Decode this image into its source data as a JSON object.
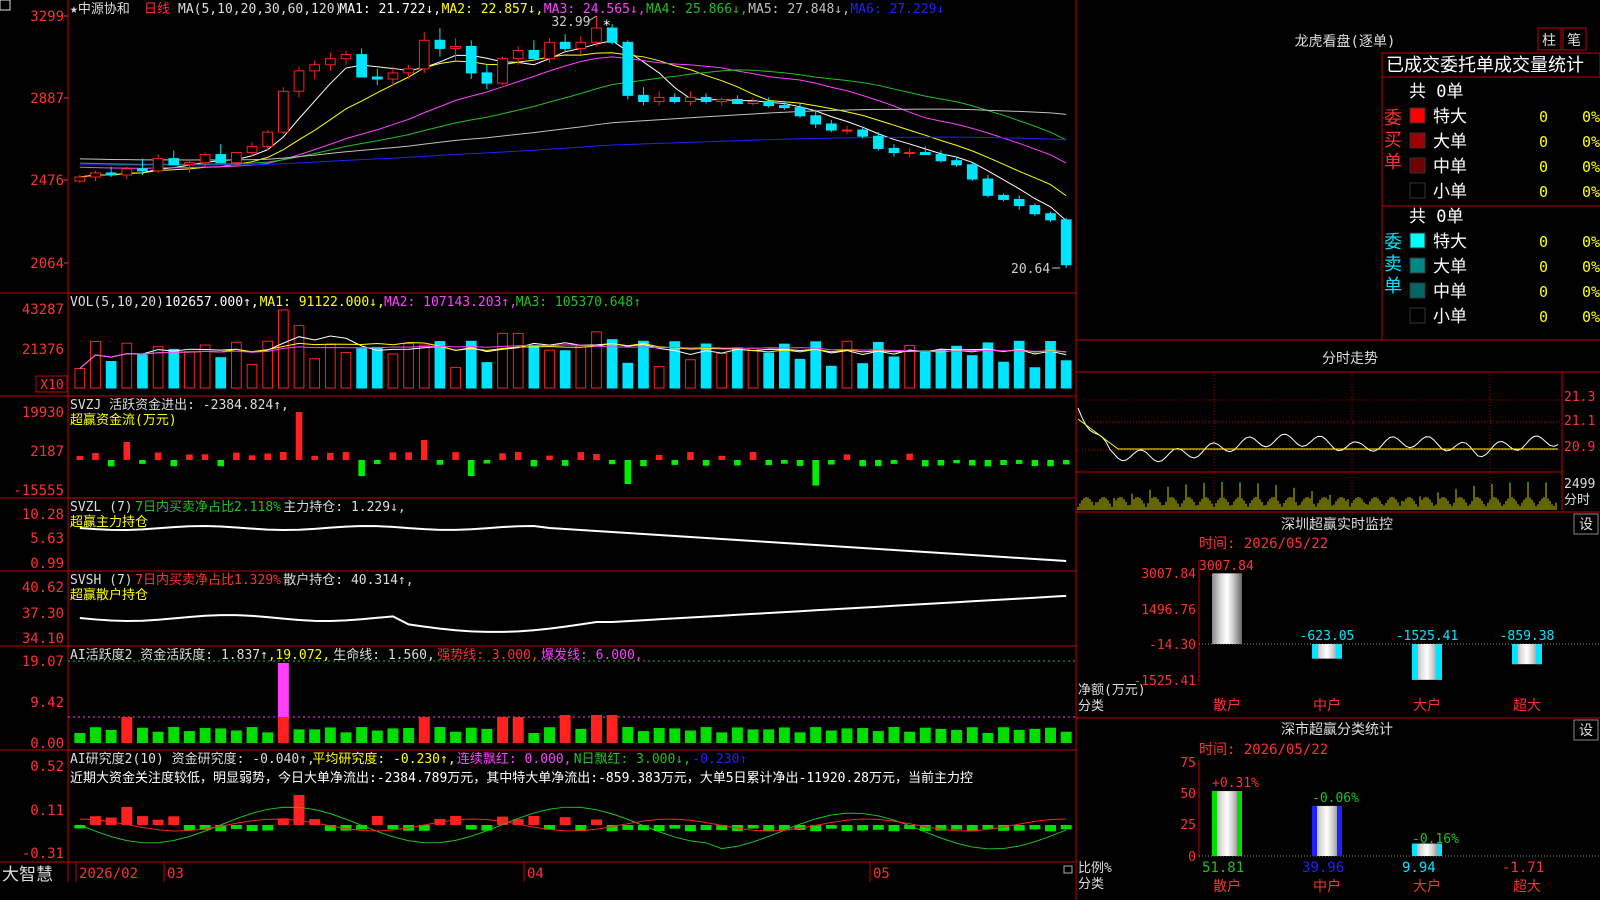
{
  "app_title": "★中源协和",
  "period_label": "日线",
  "bottom_logo": "大智慧",
  "colors": {
    "up": "#ff2020",
    "down": "#00e5ff",
    "ma1": "#ffffff",
    "ma2": "#ffff00",
    "ma3": "#ff40ff",
    "ma4": "#20c020",
    "ma5": "#c0c0c0",
    "ma6": "#2020ff",
    "frame": "#c00000",
    "axis_text": "#ff3030"
  },
  "main_panel": {
    "ma_header": [
      {
        "label": "MA(5,10,20,30,60,120)",
        "color": "#dddddd"
      },
      {
        "label": "MA1: 21.722↓,",
        "color": "#ffffff"
      },
      {
        "label": "MA2: 22.857↓,",
        "color": "#ffff00"
      },
      {
        "label": "MA3: 24.565↓,",
        "color": "#ff40ff"
      },
      {
        "label": "MA4: 25.866↓,",
        "color": "#20c020"
      },
      {
        "label": "MA5: 27.848↓,",
        "color": "#c0c0c0"
      },
      {
        "label": "MA6: 27.229↓",
        "color": "#2020ff"
      }
    ],
    "y_ticks": [
      "3299",
      "2887",
      "2476",
      "2064"
    ],
    "high_label": "32.99",
    "low_label": "20.64"
  },
  "vol_panel": {
    "header": [
      {
        "label": "VOL(5,10,20)",
        "color": "#dddddd"
      },
      {
        "label": "102657.000↑,",
        "color": "#ffffff"
      },
      {
        "label": "MA1: 91122.000↓,",
        "color": "#ffff00"
      },
      {
        "label": "MA2: 107143.203↑,",
        "color": "#ff40ff"
      },
      {
        "label": "MA3: 105370.648↑",
        "color": "#20c020"
      }
    ],
    "y_ticks": [
      "43287",
      "21376"
    ],
    "unit": "X10"
  },
  "svzj_panel": {
    "header": [
      {
        "label": "SVZJ  活跃资金进出: -2384.824↑,",
        "color": "#dddddd"
      }
    ],
    "subtitle": "超赢资金流(万元)",
    "y_ticks": [
      "19930",
      "2187",
      "-15555"
    ]
  },
  "svzl_panel": {
    "header": [
      {
        "label": "SVZL (7)",
        "color": "#dddddd"
      },
      {
        "label": "7日内买卖净占比2.118%",
        "color": "#20c020"
      },
      {
        "label": "主力持仓: 1.229↓,",
        "color": "#dddddd"
      }
    ],
    "subtitle": "超赢主力持仓",
    "y_ticks": [
      "10.28",
      "5.63",
      "0.99"
    ]
  },
  "svsh_panel": {
    "header": [
      {
        "label": "SVSH (7)",
        "color": "#dddddd"
      },
      {
        "label": "7日内买卖净占比1.329%",
        "color": "#ff3030"
      },
      {
        "label": "散户持仓: 40.314↑,",
        "color": "#dddddd"
      }
    ],
    "subtitle": "超赢散户持仓",
    "y_ticks": [
      "40.62",
      "37.30",
      "34.10"
    ]
  },
  "ai_active_panel": {
    "header": [
      {
        "label": "AI活跃度2 资金活跃度: 1.837↑,",
        "color": "#dddddd"
      },
      {
        "label": "19.072,",
        "color": "#ffff00"
      },
      {
        "label": "生命线: 1.560,",
        "color": "#dddddd"
      },
      {
        "label": "强势线: 3.000,",
        "color": "#ff3030"
      },
      {
        "label": "爆发线: 6.000,",
        "color": "#ff40ff"
      }
    ],
    "y_ticks": [
      "19.07",
      "9.42",
      "0.00"
    ]
  },
  "ai_research_panel": {
    "header": [
      {
        "label": "AI研究度2(10) 资金研究度: -0.040↑,",
        "color": "#dddddd"
      },
      {
        "label": "平均研究度: -0.230↑,",
        "color": "#ffff00"
      },
      {
        "label": "连续飘红: 0.000,",
        "color": "#ff40ff"
      },
      {
        "label": "N日飘红: 3.000↓,",
        "color": "#20c020"
      },
      {
        "label": "-0.230↑",
        "color": "#2020ff"
      }
    ],
    "comment": "近期大资金关注度较低，明显弱势，今日大单净流出:-2384.789万元，其中特大单净流出:-859.383万元，大单5日累计净出-11920.28万元，当前主力控",
    "y_ticks": [
      "0.52",
      "0.11",
      "-0.31"
    ]
  },
  "date_axis": [
    "2026/02",
    "03",
    "04",
    "05"
  ],
  "right_panel": {
    "dragon_title": "龙虎看盘(逐单)",
    "dragon_tabs": [
      "柱",
      "笔"
    ],
    "order_title": "已成交委托单成交量统计",
    "buy_label": "委买单",
    "sell_label": "委卖单",
    "buy_total": "共 0单",
    "sell_total": "共 0单",
    "buy_rows": [
      {
        "name": "特大",
        "val": "0",
        "pct": "0%",
        "color": "#ff0000"
      },
      {
        "name": "大单",
        "val": "0",
        "pct": "0%",
        "color": "#a00000"
      },
      {
        "name": "中单",
        "val": "0",
        "pct": "0%",
        "color": "#700000"
      },
      {
        "name": "小单",
        "val": "0",
        "pct": "0%",
        "color": "#000000"
      }
    ],
    "sell_rows": [
      {
        "name": "特大",
        "val": "0",
        "pct": "0%",
        "color": "#00ffff"
      },
      {
        "name": "大单",
        "val": "0",
        "pct": "0%",
        "color": "#008888"
      },
      {
        "name": "中单",
        "val": "0",
        "pct": "0%",
        "color": "#006666"
      },
      {
        "name": "小单",
        "val": "0",
        "pct": "0%",
        "color": "#000000"
      }
    ],
    "intraday_title": "分时走势",
    "intraday_ticks": [
      "21.3",
      "21.1",
      "20.9",
      "2499",
      "分时"
    ],
    "monitor_title": "深圳超赢实时监控",
    "monitor_setting": "设",
    "monitor_time": "时间: 2026/05/22",
    "monitor_y_ticks": [
      "3007.84",
      "1496.76",
      "-14.30",
      "-1525.41"
    ],
    "monitor_ylabel": "净额(万元)",
    "monitor_xlabel": "分类",
    "monitor_categories": [
      "散户",
      "中户",
      "大户",
      "超大"
    ],
    "monitor_values": [
      3007.84,
      -623.05,
      -1525.41,
      -859.38
    ],
    "monitor_top_value": "3007.84",
    "monitor_labels": [
      "-623.05",
      "-1525.41",
      "-859.38"
    ],
    "stats_title": "深市超赢分类统计",
    "stats_setting": "设",
    "stats_time": "时间: 2026/05/22",
    "stats_y_ticks": [
      "75",
      "50",
      "25",
      "0"
    ],
    "stats_ylabel": "比例%",
    "stats_xlabel": "分类",
    "stats_categories": [
      "散户",
      "中户",
      "大户",
      "超大"
    ],
    "stats_change_labels": [
      "+0.31%",
      "-0.06%",
      "-0.16%",
      ""
    ],
    "stats_values": [
      51.81,
      39.96,
      9.94,
      -1.71
    ],
    "stats_value_labels": [
      "51.81",
      "39.96",
      "9.94",
      "-1.71"
    ]
  },
  "chart_data": [
    {
      "type": "candlestick",
      "title": "",
      "ylim": [
        20.64,
        32.99
      ],
      "candles": [
        [
          24.9,
          25.2,
          24.8,
          25.1
        ],
        [
          25.1,
          25.4,
          24.9,
          25.3
        ],
        [
          25.3,
          25.6,
          25.1,
          25.2
        ],
        [
          25.2,
          25.6,
          25.0,
          25.5
        ],
        [
          25.5,
          26.0,
          25.2,
          25.4
        ],
        [
          25.4,
          26.2,
          25.3,
          26.0
        ],
        [
          26.0,
          26.4,
          25.8,
          25.7
        ],
        [
          25.7,
          26.0,
          25.3,
          25.8
        ],
        [
          25.8,
          26.3,
          25.6,
          26.2
        ],
        [
          26.2,
          26.7,
          26.0,
          25.8
        ],
        [
          25.8,
          26.3,
          25.6,
          26.3
        ],
        [
          26.3,
          26.8,
          26.1,
          26.6
        ],
        [
          26.6,
          27.4,
          26.4,
          27.3
        ],
        [
          27.3,
          29.5,
          27.2,
          29.3
        ],
        [
          29.3,
          30.5,
          29.0,
          30.3
        ],
        [
          30.3,
          30.8,
          29.9,
          30.6
        ],
        [
          30.6,
          31.2,
          30.3,
          30.9
        ],
        [
          30.9,
          31.3,
          30.6,
          31.1
        ],
        [
          31.1,
          31.4,
          30.0,
          30.0
        ],
        [
          30.0,
          30.4,
          29.6,
          29.9
        ],
        [
          29.9,
          30.5,
          29.6,
          30.2
        ],
        [
          30.2,
          30.6,
          29.9,
          30.4
        ],
        [
          30.4,
          32.2,
          30.2,
          31.8
        ],
        [
          31.8,
          32.4,
          31.0,
          31.4
        ],
        [
          31.4,
          31.9,
          30.8,
          31.5
        ],
        [
          31.5,
          31.8,
          29.9,
          30.2
        ],
        [
          30.2,
          30.6,
          29.4,
          29.7
        ],
        [
          29.7,
          31.0,
          29.6,
          30.9
        ],
        [
          30.9,
          31.5,
          30.6,
          31.3
        ],
        [
          31.3,
          31.8,
          30.9,
          30.9
        ],
        [
          30.9,
          31.9,
          30.7,
          31.7
        ],
        [
          31.7,
          32.1,
          31.2,
          31.4
        ],
        [
          31.4,
          32.0,
          31.1,
          31.7
        ],
        [
          31.7,
          32.99,
          31.5,
          32.4
        ],
        [
          32.4,
          32.6,
          31.6,
          31.7
        ],
        [
          31.7,
          31.8,
          28.9,
          29.1
        ],
        [
          29.1,
          29.5,
          28.6,
          28.8
        ],
        [
          28.8,
          29.3,
          28.6,
          29.0
        ],
        [
          29.0,
          29.2,
          28.7,
          28.8
        ],
        [
          28.8,
          29.3,
          28.6,
          29.0
        ],
        [
          29.0,
          29.2,
          28.7,
          28.8
        ],
        [
          28.8,
          29.0,
          28.6,
          28.9
        ],
        [
          28.9,
          29.1,
          28.7,
          28.7
        ],
        [
          28.7,
          29.0,
          28.6,
          28.8
        ],
        [
          28.8,
          29.0,
          28.5,
          28.6
        ],
        [
          28.6,
          28.8,
          28.4,
          28.5
        ],
        [
          28.5,
          28.7,
          28.0,
          28.1
        ],
        [
          28.1,
          28.4,
          27.5,
          27.7
        ],
        [
          27.7,
          27.9,
          27.3,
          27.4
        ],
        [
          27.4,
          27.6,
          27.2,
          27.4
        ],
        [
          27.4,
          27.5,
          27.0,
          27.1
        ],
        [
          27.1,
          27.3,
          26.4,
          26.5
        ],
        [
          26.5,
          26.7,
          26.1,
          26.3
        ],
        [
          26.3,
          26.5,
          26.1,
          26.3
        ],
        [
          26.3,
          26.6,
          26.2,
          26.2
        ],
        [
          26.2,
          26.4,
          25.8,
          25.9
        ],
        [
          25.9,
          26.1,
          25.6,
          25.7
        ],
        [
          25.7,
          25.8,
          24.9,
          25.0
        ],
        [
          25.0,
          25.2,
          24.1,
          24.2
        ],
        [
          24.2,
          24.3,
          23.9,
          24.0
        ],
        [
          24.0,
          24.2,
          23.5,
          23.7
        ],
        [
          23.7,
          23.8,
          23.2,
          23.3
        ],
        [
          23.3,
          23.4,
          22.9,
          23.0
        ],
        [
          23.0,
          23.1,
          20.64,
          20.8
        ]
      ]
    }
  ]
}
